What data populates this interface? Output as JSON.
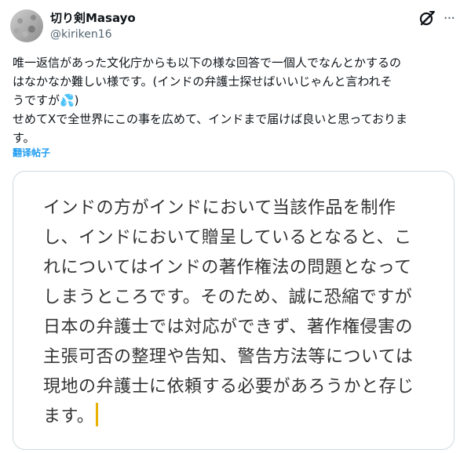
{
  "author": {
    "display_name": "切り剣Masayo",
    "handle": "@kiriken16",
    "avatar_icon": "avatar-image"
  },
  "header_icons": {
    "grok": "grok-icon",
    "more": "more-options-icon"
  },
  "tweet": {
    "lines": [
      "唯一返信があった文化庁からも以下の様な回答で一個人でなんとかするの",
      "はなかなか難しい様です。(インドの弁護士探せばいいじゃんと言われそ",
      "うですが💦)",
      "せめてXで全世界にこの事を広めて、インドまで届けば良いと思っておりま",
      "す。"
    ],
    "translate_label": "翻译帖子"
  },
  "media": {
    "lines": [
      "インドの方がインドにおいて当該作品を制作",
      "し、インドにおいて贈呈しているとなると、こ",
      "れについてはインドの著作権法の問題となって",
      "しまうところです。そのため、誠に恐縮ですが",
      "日本の弁護士では対応ができず、著作権侵害の",
      "主張可否の整理や告知、警告方法等については",
      "現地の弁護士に依頼する必要があろうかと存じ",
      "ます。"
    ]
  },
  "colors": {
    "text": "#0f1419",
    "secondary": "#536471",
    "link": "#1d9bf0",
    "border": "#cfd9de",
    "cursor": "#e8b000"
  }
}
